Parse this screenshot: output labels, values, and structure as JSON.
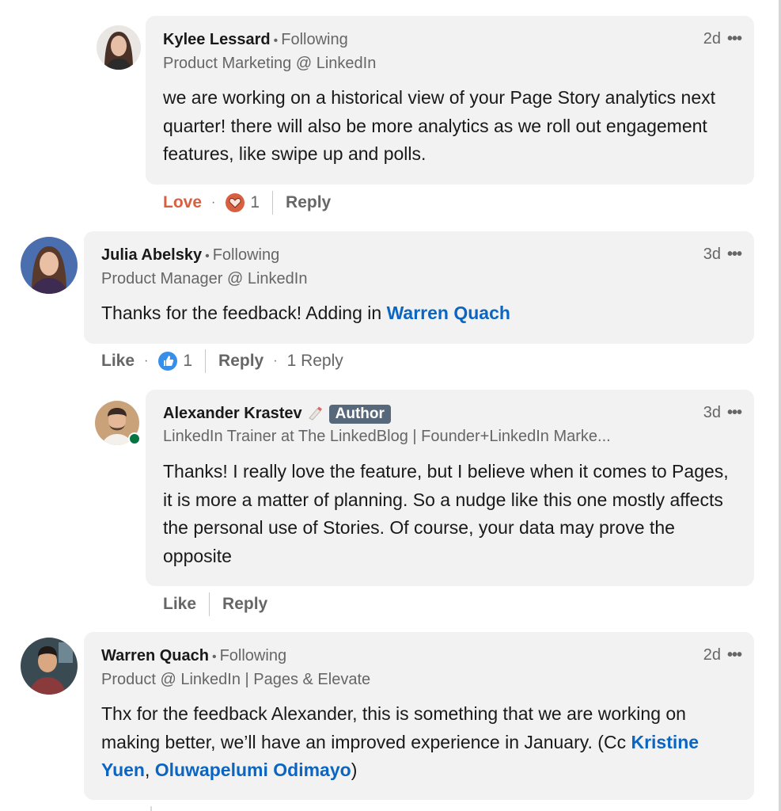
{
  "comments": [
    {
      "name": "Kylee Lessard",
      "following": "Following",
      "headline": "Product Marketing @ LinkedIn",
      "time": "2d",
      "text": "we are working on a historical view of your Page Story analytics next quarter! there will also be more analytics as we roll out engagement features, like swipe up and polls.",
      "reaction_label": "Love",
      "reaction_count": "1",
      "reply_label": "Reply",
      "avatar_icon": "person-avatar"
    },
    {
      "name": "Julia Abelsky",
      "following": "Following",
      "headline": "Product Manager @ LinkedIn",
      "time": "3d",
      "text_prefix": "Thanks for the feedback! Adding in ",
      "mention": "Warren Quach",
      "reaction_label": "Like",
      "reaction_count": "1",
      "reply_label": "Reply",
      "replies_count": "1 Reply",
      "avatar_icon": "person-avatar"
    },
    {
      "name": "Alexander Krastev",
      "badge": "Author",
      "headline": "LinkedIn Trainer at The LinkedBlog | Founder+LinkedIn Marke...",
      "time": "3d",
      "text": "Thanks! I really love the feature, but I believe when it comes to Pages, it is more a matter of planning. So a nudge like this one mostly affects the personal use of Stories. Of course, your data may prove the opposite",
      "reaction_label": "Like",
      "reply_label": "Reply",
      "avatar_icon": "person-avatar",
      "status_icon": "online-status-icon"
    },
    {
      "name": "Warren Quach",
      "following": "Following",
      "headline": "Product @ LinkedIn | Pages & Elevate",
      "time": "2d",
      "text_prefix": "Thx for the feedback Alexander, this is something that we are working on making better, we’ll have an improved experience in January. (Cc ",
      "mention_1": "Kristine Yuen",
      "text_mid": ", ",
      "mention_2": "Oluwapelumi Odimayo",
      "text_suffix": ")",
      "avatar_icon": "person-avatar"
    }
  ],
  "colors": {
    "bubble": "#f2f2f2",
    "mention": "#0a66c2",
    "love": "#d85f3f",
    "like": "#378fe9",
    "author_badge": "#56687a",
    "online": "#057642"
  },
  "menu_icon": "more-options-icon"
}
